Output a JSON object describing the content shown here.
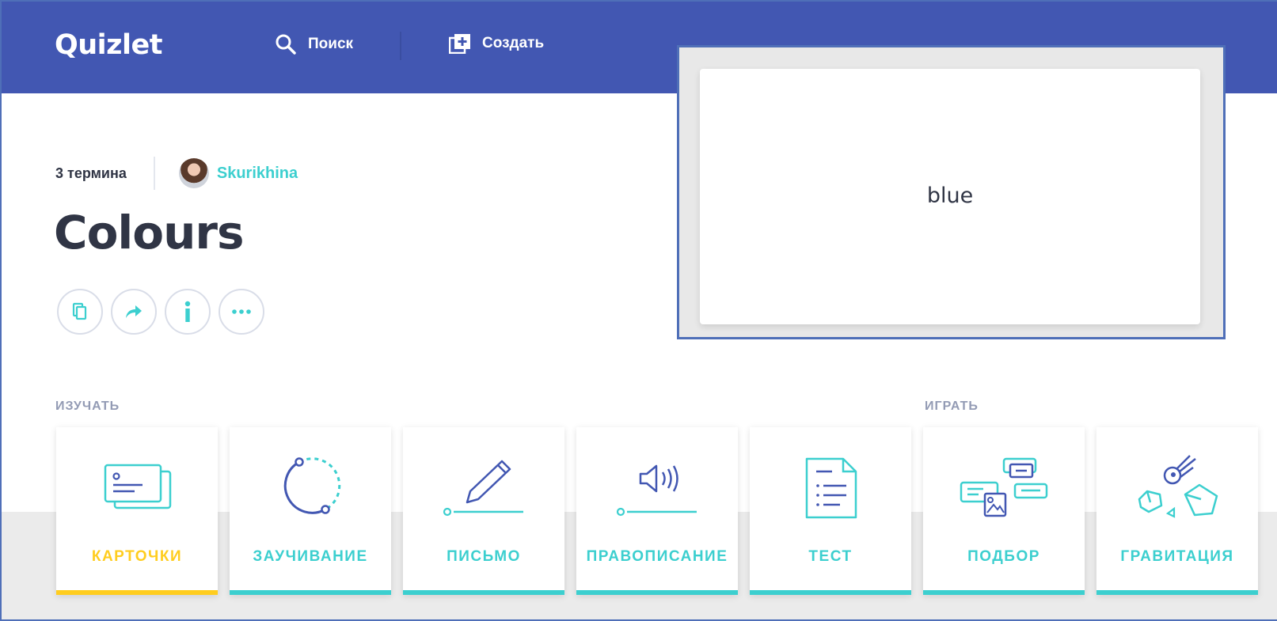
{
  "header": {
    "logo": "Quizlet",
    "search_label": "Поиск",
    "create_label": "Создать",
    "bg_color": "#4257b2"
  },
  "set": {
    "term_count": "3 термина",
    "author": "Skurikhina",
    "title": "Colours"
  },
  "actions": [
    {
      "icon": "copy-icon"
    },
    {
      "icon": "share-icon"
    },
    {
      "icon": "info-icon"
    },
    {
      "icon": "more-icon"
    }
  ],
  "sections": {
    "study": "ИЗУЧАТЬ",
    "play": "ИГРАТЬ"
  },
  "modes": [
    {
      "label": "КАРТОЧКИ",
      "icon": "flashcards-icon",
      "active": true
    },
    {
      "label": "ЗАУЧИВАНИЕ",
      "icon": "learn-icon"
    },
    {
      "label": "ПИСЬМО",
      "icon": "write-icon"
    },
    {
      "label": "ПРАВОПИСАНИЕ",
      "icon": "spell-icon"
    },
    {
      "label": "ТЕСТ",
      "icon": "test-icon"
    },
    {
      "label": "ПОДБОР",
      "icon": "match-icon"
    },
    {
      "label": "ГРАВИТАЦИЯ",
      "icon": "gravity-icon"
    }
  ],
  "preview": {
    "term": "blue"
  },
  "colors": {
    "accent_teal": "#3ccfcf",
    "accent_yellow": "#ffcd1f",
    "icon_blue": "#4257b2"
  }
}
